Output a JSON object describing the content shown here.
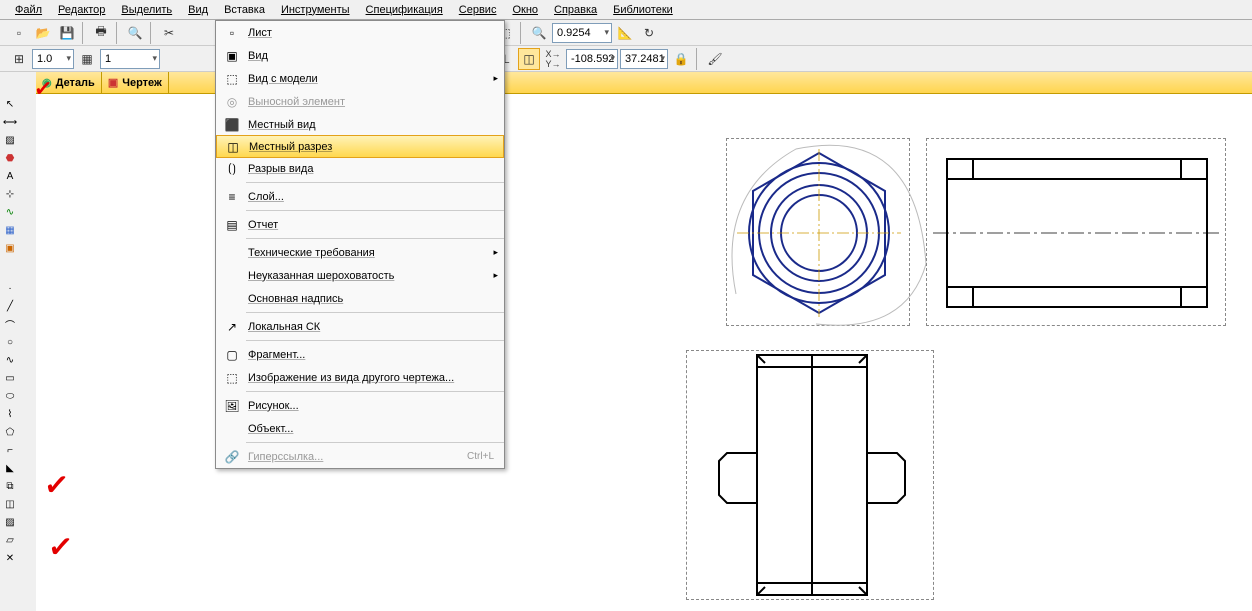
{
  "menubar": [
    "Файл",
    "Редактор",
    "Выделить",
    "Вид",
    "Вставка",
    "Инструменты",
    "Спецификация",
    "Сервис",
    "Окно",
    "Справка",
    "Библиотеки"
  ],
  "toolbar2": {
    "thickness": "1.0",
    "step": "1"
  },
  "tabs": {
    "detail": "Деталь",
    "drawing": "Чертеж"
  },
  "zoom": "0.9254",
  "coords": {
    "x": "-108.592",
    "y": "37.2481"
  },
  "dropdown": [
    {
      "icon": "sheet",
      "label": "Лист",
      "type": "item"
    },
    {
      "icon": "view",
      "label": "Вид",
      "type": "item"
    },
    {
      "icon": "model",
      "label": "Вид с модели",
      "type": "sub"
    },
    {
      "icon": "callout",
      "label": "Выносной элемент",
      "type": "disabled"
    },
    {
      "icon": "local-view",
      "label": "Местный вид",
      "type": "item"
    },
    {
      "icon": "local-cut",
      "label": "Местный разрез",
      "type": "highlight"
    },
    {
      "icon": "break",
      "label": "Разрыв вида",
      "type": "item"
    },
    {
      "type": "sep"
    },
    {
      "icon": "layer",
      "label": "Слой...",
      "type": "item"
    },
    {
      "type": "sep"
    },
    {
      "icon": "report",
      "label": "Отчет",
      "type": "item"
    },
    {
      "type": "sep"
    },
    {
      "icon": "tech",
      "label": "Технические требования",
      "type": "sub"
    },
    {
      "icon": "rough",
      "label": "Неуказанная шероховатость",
      "type": "sub"
    },
    {
      "icon": "title",
      "label": "Основная надпись",
      "type": "item"
    },
    {
      "type": "sep"
    },
    {
      "icon": "lcs",
      "label": "Локальная СК",
      "type": "item"
    },
    {
      "type": "sep"
    },
    {
      "icon": "fragment",
      "label": "Фрагмент...",
      "type": "item"
    },
    {
      "icon": "image",
      "label": "Изображение из вида другого чертежа...",
      "type": "item"
    },
    {
      "type": "sep"
    },
    {
      "icon": "picture",
      "label": "Рисунок...",
      "type": "item"
    },
    {
      "icon": "object",
      "label": "Объект...",
      "type": "item"
    },
    {
      "type": "sep"
    },
    {
      "icon": "link",
      "label": "Гиперссылка...",
      "type": "disabled",
      "shortcut": "Ctrl+L"
    }
  ]
}
